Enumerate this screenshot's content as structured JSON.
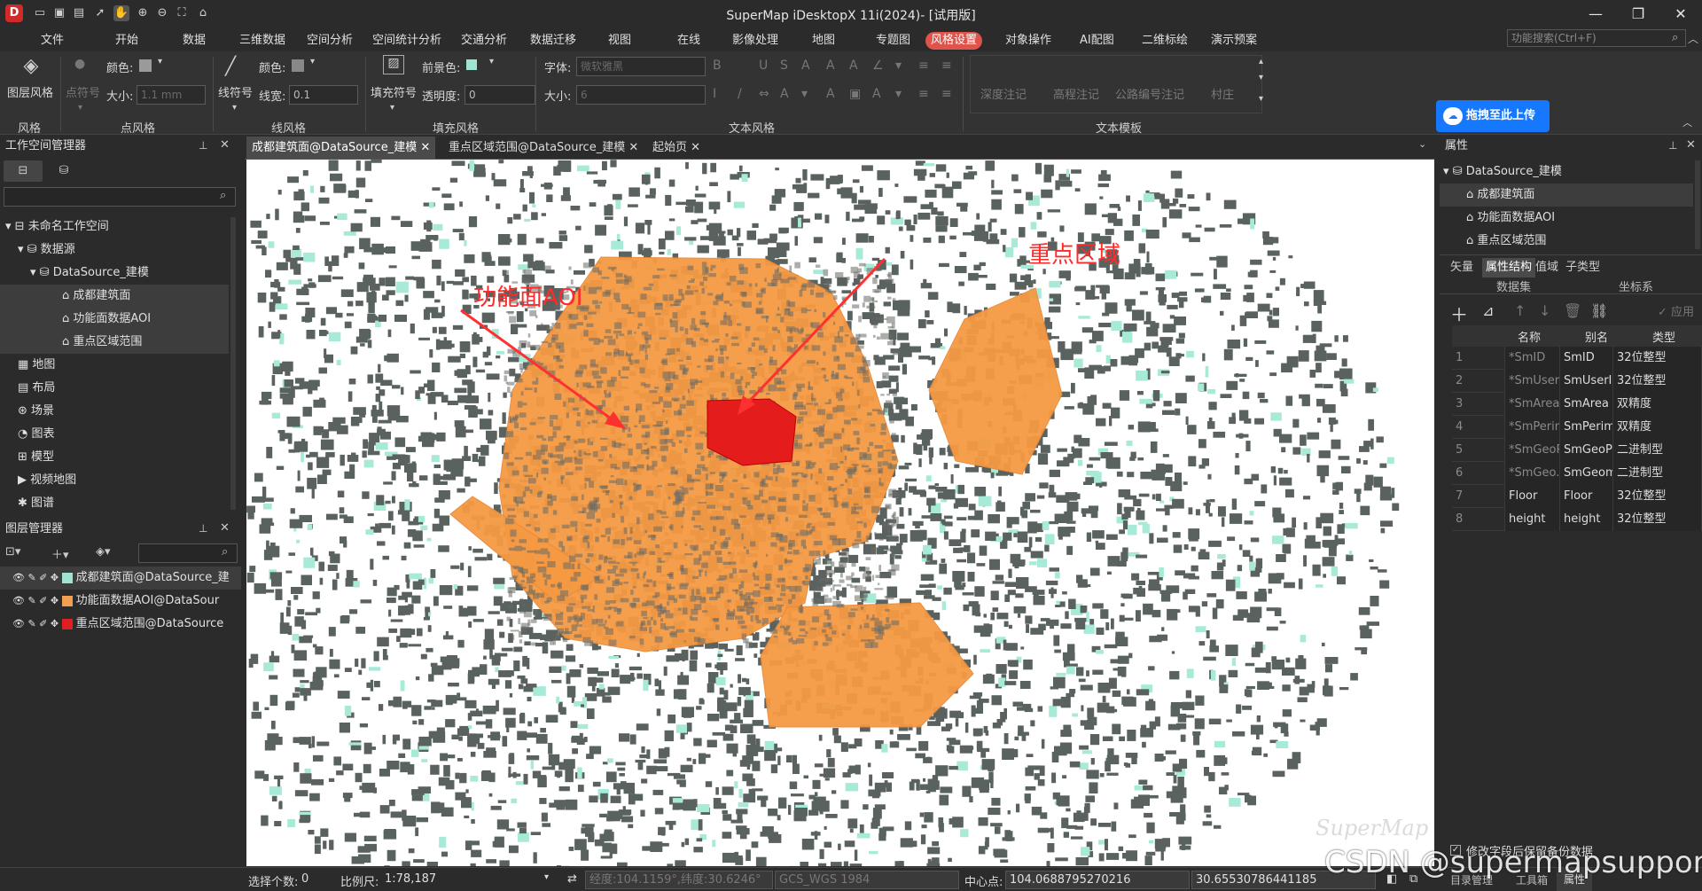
{
  "window": {
    "title": "SuperMap iDesktopX 11i(2024)- [试用版]",
    "logo_letter": "D",
    "controls": {
      "minimize": "—",
      "maximize": "❐",
      "close": "✕"
    }
  },
  "menus": [
    "文件",
    "开始",
    "数据",
    "三维数据",
    "空间分析",
    "空间统计分析",
    "交通分析",
    "数据迁移",
    "视图",
    "在线",
    "影像处理",
    "地图",
    "专题图",
    "风格设置",
    "对象操作",
    "AI配图",
    "二维标绘",
    "演示预案"
  ],
  "active_menu": "风格设置",
  "search": {
    "placeholder": "功能搜索(Ctrl+F)"
  },
  "ribbon": {
    "groups": [
      "风格",
      "点风格",
      "线风格",
      "填充风格",
      "文本风格",
      "文本模板"
    ],
    "layer_style": "图层风格",
    "point": {
      "symbol": "点符号",
      "color": "颜色:",
      "size": "大小:",
      "size_value": "1.1 mm"
    },
    "line": {
      "symbol": "线符号",
      "color": "颜色:",
      "width": "线宽:",
      "width_value": "0.1"
    },
    "fill": {
      "symbol": "填充符号",
      "foreground": "前景色:",
      "opacity": "透明度:",
      "opacity_value": "0"
    },
    "text": {
      "font": "字体:",
      "font_value": "微软雅黑",
      "size": "大小:",
      "size_value": "6"
    },
    "templates": [
      "深度注记",
      "高程注记",
      "公路编号注记",
      "村庄"
    ],
    "upload_button": "拖拽至此上传"
  },
  "workspace_panel": {
    "title": "工作空间管理器",
    "items": [
      {
        "label": "未命名工作空间",
        "level": 0
      },
      {
        "label": "数据源",
        "level": 1
      },
      {
        "label": "DataSource_建模",
        "level": 2
      },
      {
        "label": "成都建筑面",
        "level": 3
      },
      {
        "label": "功能面数据AOI",
        "level": 3
      },
      {
        "label": "重点区域范围",
        "level": 3
      },
      {
        "label": "地图",
        "level": 1
      },
      {
        "label": "布局",
        "level": 1
      },
      {
        "label": "场景",
        "level": 1
      },
      {
        "label": "图表",
        "level": 1
      },
      {
        "label": "模型",
        "level": 1
      },
      {
        "label": "视频地图",
        "level": 1
      },
      {
        "label": "图谱",
        "level": 1
      }
    ]
  },
  "layer_panel": {
    "title": "图层管理器",
    "layers": [
      {
        "label": "成都建筑面@DataSource_建",
        "color": "#9fe3d2"
      },
      {
        "label": "功能面数据AOI@DataSour",
        "color": "#f0a050"
      },
      {
        "label": "重点区域范围@DataSource",
        "color": "#e02020"
      }
    ]
  },
  "doc_tabs": [
    "成都建筑面@DataSource_建模",
    "重点区域范围@DataSource_建模",
    "起始页"
  ],
  "map": {
    "label_aoi": "功能面AOI",
    "label_key": "重点区域",
    "watermark": "SuperMap"
  },
  "properties_panel": {
    "title": "属性",
    "tree": [
      "DataSource_建模",
      "成都建筑面",
      "功能面数据AOI",
      "重点区域范围"
    ],
    "tabs": [
      "矢量",
      "属性结构",
      "值域",
      "子类型"
    ],
    "active_tab": "属性结构",
    "subtabs": [
      "数据集",
      "坐标系"
    ],
    "apply": "应用",
    "columns": [
      "名称",
      "别名",
      "类型"
    ],
    "rows": [
      [
        "1",
        "*SmID",
        "SmID",
        "32位整型"
      ],
      [
        "2",
        "*SmUserID",
        "SmUserID",
        "32位整型"
      ],
      [
        "3",
        "*SmArea",
        "SmArea",
        "双精度"
      ],
      [
        "4",
        "*SmPerim...",
        "SmPerim...",
        "双精度"
      ],
      [
        "5",
        "*SmGeoP...",
        "SmGeoPa...",
        "二进制型"
      ],
      [
        "6",
        "*SmGeo...",
        "SmGeom...",
        "二进制型"
      ],
      [
        "7",
        "Floor",
        "Floor",
        "32位整型"
      ],
      [
        "8",
        "height",
        "height",
        "32位整型"
      ]
    ],
    "checkbox_label": "修改字段后保留备份数据",
    "bottom_tabs": [
      "目录管理",
      "工具箱",
      "属性"
    ]
  },
  "status": {
    "selected_label": "选择个数:",
    "selected_value": "0",
    "scale_label": "比例尺:",
    "scale_value": "1:78,187",
    "coord_text": "经度:104.1159°,纬度:30.6246°",
    "crs": "GCS_WGS 1984",
    "center_label": "中心点:",
    "center_x": "104.0688795270216",
    "center_y": "30.65530786441185"
  },
  "overlay_watermark": "CSDN @supermapsupport"
}
